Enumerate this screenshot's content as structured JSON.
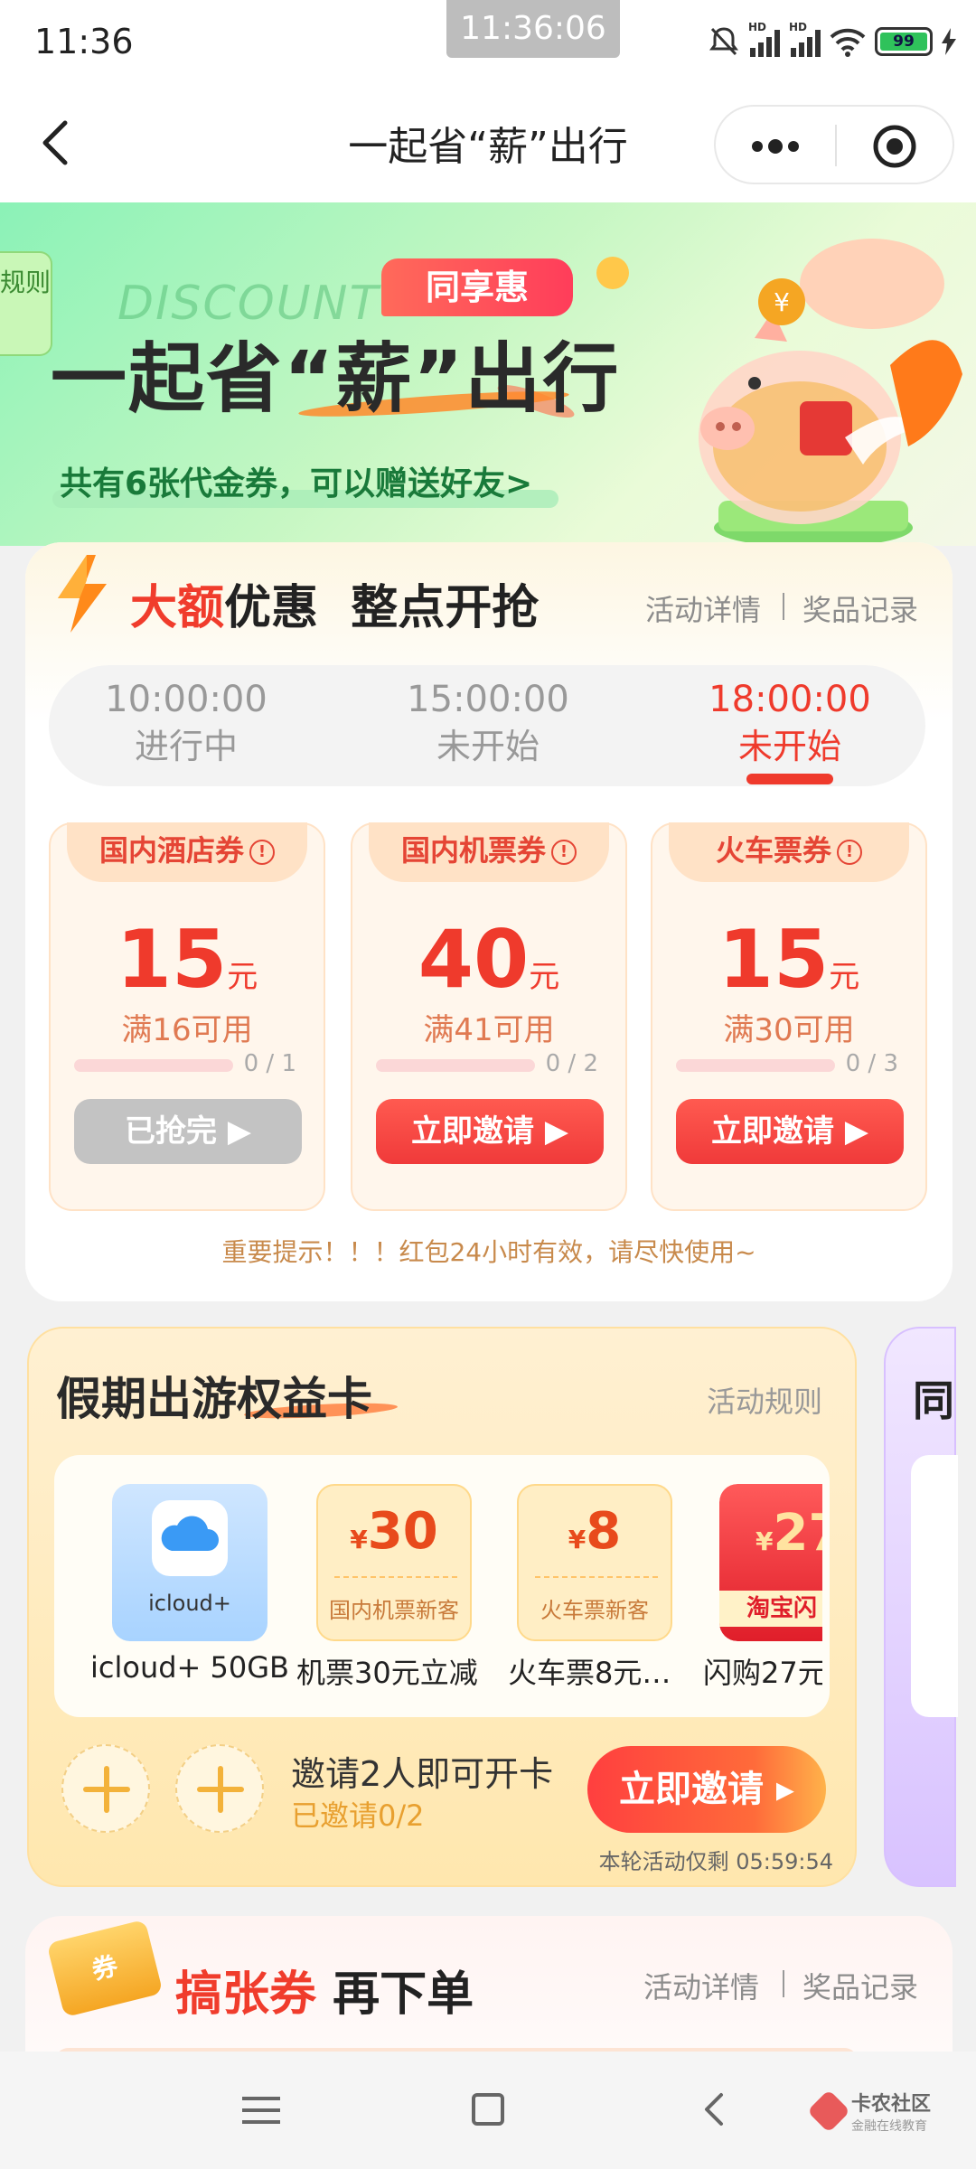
{
  "status_bar": {
    "time": "11:36",
    "clock_overlay": "11:36:06",
    "battery": "99",
    "hd1": "HD",
    "hd2": "HD"
  },
  "header": {
    "title": "一起省“薪”出行"
  },
  "hero": {
    "rule_tab": "规则",
    "disc_text": "DISCOUNT",
    "badge": "同享惠",
    "title": "一起省“薪”出行",
    "subtitle": "共有6张代金券，可以赠送好友>"
  },
  "section1": {
    "title_red": "大额",
    "title_rest": "优惠  整点开抢",
    "link_detail": "活动详情",
    "link_record": "奖品记录",
    "times": [
      {
        "time": "10:00:00",
        "status": "进行中"
      },
      {
        "time": "15:00:00",
        "status": "未开始"
      },
      {
        "time": "18:00:00",
        "status": "未开始"
      }
    ],
    "active_time_index": 2,
    "coupons": [
      {
        "name": "国内酒店券",
        "amount": "15",
        "unit": "元",
        "condition": "满16可用",
        "progress": "0 / 1",
        "button": "已抢完 ▶",
        "state": "sold-out"
      },
      {
        "name": "国内机票券",
        "amount": "40",
        "unit": "元",
        "condition": "满41可用",
        "progress": "0 / 2",
        "button": "立即邀请 ▶",
        "state": "invite"
      },
      {
        "name": "火车票券",
        "amount": "15",
        "unit": "元",
        "condition": "满30可用",
        "progress": "0 / 3",
        "button": "立即邀请 ▶",
        "state": "invite"
      }
    ],
    "notice": "重要提示！！！红包24小时有效，请尽快使用~"
  },
  "section2": {
    "title": "假期出游权益卡",
    "rule": "活动规则",
    "side_peek_char": "同",
    "benefits": [
      {
        "tile_label": "icloud+",
        "name": "icloud+ 50GB"
      },
      {
        "tile_amount": "30",
        "currency": "¥",
        "tile_label": "国内机票新客",
        "name": "机票30元立减"
      },
      {
        "tile_amount": "8",
        "currency": "¥",
        "tile_label": "火车票新客",
        "name": "火车票8元…"
      },
      {
        "tile_amount": "27",
        "currency": "¥",
        "tile_label": "淘宝闪",
        "name": "闪购27元"
      }
    ],
    "invite_main": "邀请2人即可开卡",
    "invite_sub": "已邀请0/2",
    "invite_button": "立即邀请 ▸",
    "countdown": "本轮活动仅剩 05:59:54"
  },
  "section3": {
    "ticket_label": "券",
    "title_red": "搞张券",
    "title_rest": " 再下单",
    "link_detail": "活动详情",
    "link_record": "奖品记录"
  },
  "watermark": {
    "name": "卡农社区",
    "sub": "金融在线教育"
  },
  "colors": {
    "accent_red": "#f03c2c",
    "hero_green": "#8bf2b7",
    "gold": "#f3b23a"
  }
}
